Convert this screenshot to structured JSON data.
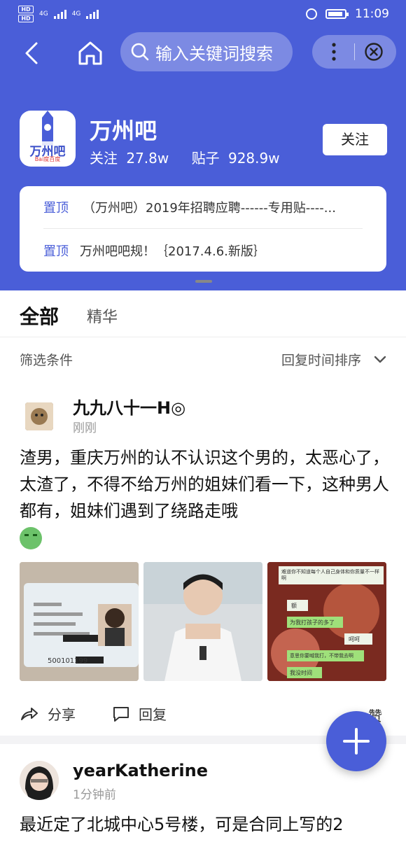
{
  "status_bar": {
    "net_badge_1": "HD",
    "net_badge_2": "HD",
    "signal_1": "4G",
    "signal_2": "4G",
    "time": "11:09"
  },
  "nav": {
    "search_placeholder": "输入关键词搜索"
  },
  "forum": {
    "name": "万州吧",
    "logo_text": "万州吧",
    "logo_brand": "Bai度百度",
    "follow_label": "关注",
    "followers_label": "关注",
    "followers_value": "27.8w",
    "posts_label": "贴子",
    "posts_value": "928.9w",
    "follow_button": "关注"
  },
  "pinned": [
    {
      "tag": "置顶",
      "title": "（万州吧）2019年招聘应聘------专用贴----..."
    },
    {
      "tag": "置顶",
      "title": "万州吧吧规！｛2017.4.6.新版｝"
    }
  ],
  "tabs": {
    "all": "全部",
    "featured": "精华"
  },
  "filter": {
    "label": "筛选条件",
    "sort": "回复时间排序"
  },
  "post1": {
    "username": "九九八十一H◎",
    "time": "刚刚",
    "body": "渣男，重庆万州的认不认识这个男的，太恶心了，太渣了，不得不给万州的姐妹们看一下，这种男人都有，姐妹们遇到了绕路走哦",
    "id_card_number": "500101199",
    "chat_lines": [
      "难道你不知道每个人自己身体和你质量不一样啊",
      "额",
      "为我打孩子的多了",
      "呵呵",
      "意思你要喊我打，不带我去啊",
      "我没时间"
    ],
    "share": "分享",
    "reply": "回复",
    "like": "赞"
  },
  "post2": {
    "username": "yearKatherine",
    "time": "1分钟前",
    "body": "最近定了北城中心5号楼，可是合同上写的2"
  },
  "colors": {
    "accent": "#4a5ed8"
  }
}
